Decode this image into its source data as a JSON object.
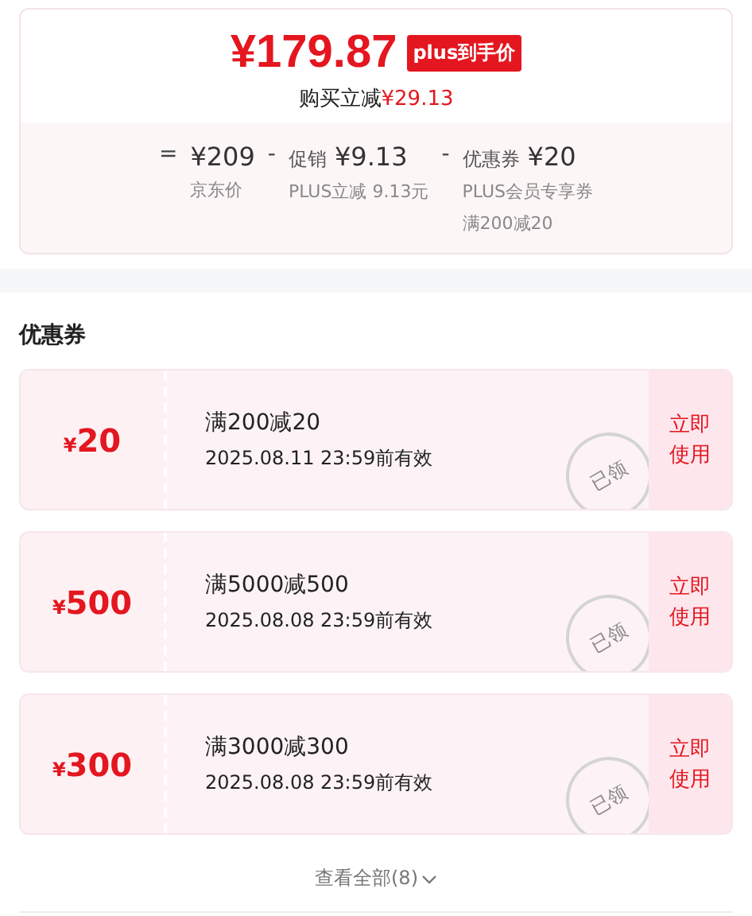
{
  "price_card": {
    "price": "¥179.87",
    "price_tag": "plus到手价",
    "saving_label": "购买立减",
    "saving_amount": "¥29.13",
    "breakdown": [
      {
        "operator": "=",
        "amount": "¥209",
        "notes": [
          "京东价"
        ]
      },
      {
        "operator": "-",
        "label": "促销",
        "amount": "¥9.13",
        "notes": [
          "PLUS立减 9.13元"
        ]
      },
      {
        "operator": "-",
        "label": "优惠券",
        "amount": "¥20",
        "notes": [
          "PLUS会员专享券",
          "满200减20"
        ]
      }
    ]
  },
  "coupons_section": {
    "title": "优惠券",
    "coupons": [
      {
        "currency": "¥",
        "value": "20",
        "condition": "满200减20",
        "validity": "2025.08.11 23:59前有效",
        "action": "立即使用",
        "claimed": true,
        "stamp_text": "已领"
      },
      {
        "currency": "¥",
        "value": "500",
        "condition": "满5000减500",
        "validity": "2025.08.08 23:59前有效",
        "action": "立即使用",
        "claimed": true,
        "stamp_text": "已领"
      },
      {
        "currency": "¥",
        "value": "300",
        "condition": "满3000减300",
        "validity": "2025.08.08 23:59前有效",
        "action": "立即使用",
        "claimed": true,
        "stamp_text": "已领"
      }
    ],
    "view_all": "查看全部(8)"
  }
}
